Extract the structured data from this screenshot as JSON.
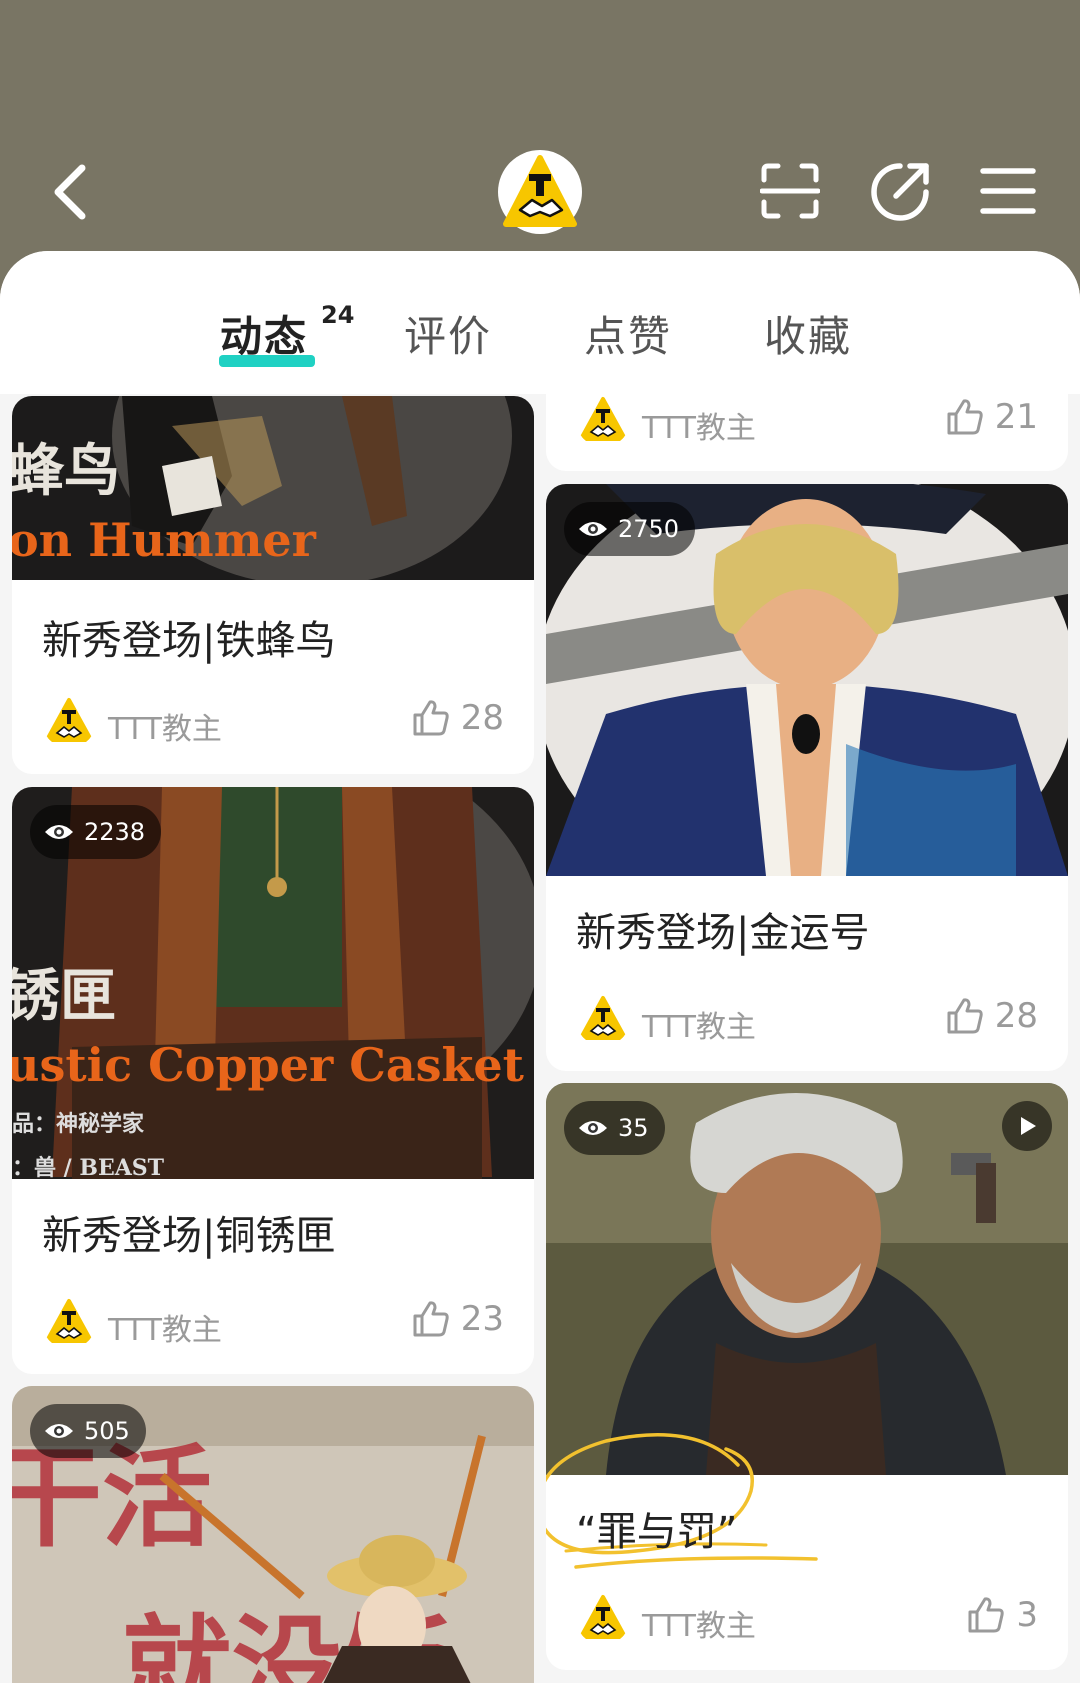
{
  "tabs": {
    "items": [
      {
        "label": "动态",
        "count": "24"
      },
      {
        "label": "评价"
      },
      {
        "label": "点赞"
      },
      {
        "label": "收藏"
      }
    ]
  },
  "left_column": [
    {
      "title": "新秀登场|铁蜂鸟",
      "author": "TTT教主",
      "likes": "28",
      "overlay_lines": [
        "蜂鸟",
        "on Hummer"
      ]
    },
    {
      "title": "新秀登场|铜锈匣",
      "views": "2238",
      "author": "TTT教主",
      "likes": "23",
      "overlay_lines": [
        "锈匣",
        "ustic Copper Casket",
        "品：神秘学家",
        "：兽 / BEAST"
      ]
    },
    {
      "views": "505",
      "overlay_lines": [
        "干活",
        "就没饭"
      ]
    }
  ],
  "right_column": [
    {
      "author": "TTT教主",
      "likes": "21"
    },
    {
      "title": "新秀登场|金运号",
      "views": "2750",
      "author": "TTT教主",
      "likes": "28"
    },
    {
      "title": "“罪与罚”",
      "views": "35",
      "author": "TTT教主",
      "likes": "3",
      "has_video": true
    }
  ],
  "colors": {
    "header_bg": "#797564",
    "accent": "#1fd1c3",
    "logo_yellow": "#f7c600"
  }
}
